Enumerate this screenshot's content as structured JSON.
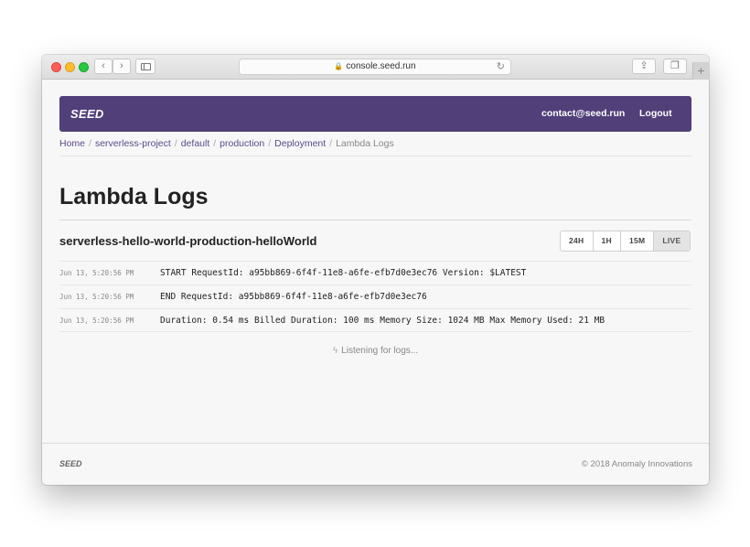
{
  "browser": {
    "url": "console.seed.run",
    "back_glyph": "‹",
    "forward_glyph": "›",
    "share_glyph": "⇪",
    "tabs_glyph": "❐",
    "plus_glyph": "+",
    "reload_glyph": "↻",
    "lock_glyph": "🔒"
  },
  "navbar": {
    "brand": "SEED",
    "contact": "contact@seed.run",
    "logout": "Logout",
    "color": "#503f79"
  },
  "breadcrumb": {
    "items": [
      "Home",
      "serverless-project",
      "default",
      "production",
      "Deployment"
    ],
    "separator": "/",
    "current": "Lambda Logs"
  },
  "page": {
    "title": "Lambda Logs",
    "function_name": "serverless-hello-world-production-helloWorld"
  },
  "ranges": {
    "options": [
      "24H",
      "1H",
      "15M",
      "LIVE"
    ],
    "selected": "LIVE"
  },
  "logs": [
    {
      "time": "Jun 13, 5:20:56 PM",
      "message": "START RequestId: a95bb869-6f4f-11e8-a6fe-efb7d0e3ec76 Version: $LATEST"
    },
    {
      "time": "Jun 13, 5:20:56 PM",
      "message": "END RequestId: a95bb869-6f4f-11e8-a6fe-efb7d0e3ec76"
    },
    {
      "time": "Jun 13, 5:20:56 PM",
      "message": "Duration: 0.54 ms Billed Duration: 100 ms Memory Size: 1024 MB Max Memory Used: 21 MB"
    }
  ],
  "status": {
    "icon": "lightning-icon",
    "text": "Listening for logs..."
  },
  "footer": {
    "brand": "SEED",
    "copyright": "© 2018 Anomaly Innovations"
  }
}
